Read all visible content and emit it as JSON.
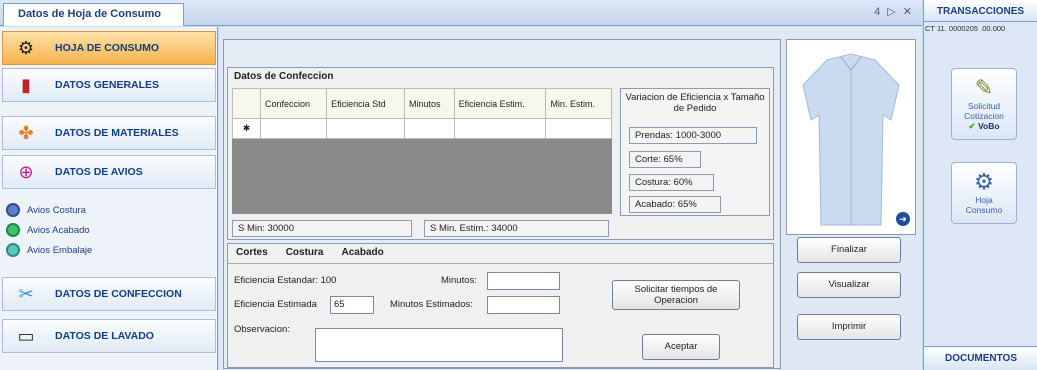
{
  "tab": {
    "title": "Datos de Hoja de Consumo",
    "controls": "4 ▷ ✕"
  },
  "sidebar": {
    "items": [
      {
        "label": "HOJA DE CONSUMO",
        "icon": "gear-doc-icon"
      },
      {
        "label": "DATOS GENERALES",
        "icon": "document-icon"
      },
      {
        "label": "DATOS DE MATERIALES",
        "icon": "shapes-icon"
      },
      {
        "label": "DATOS DE AVIOS",
        "icon": "button-icon"
      }
    ],
    "subitems": [
      "Avios Costura",
      "Avios Acabado",
      "Avios Embalaje"
    ],
    "items2": [
      {
        "label": "DATOS DE CONFECCION",
        "icon": "sewing-icon"
      },
      {
        "label": "DATOS DE LAVADO",
        "icon": "wash-icon"
      }
    ]
  },
  "confeccion": {
    "title": "Datos de Confeccion",
    "columns": [
      "Confeccion",
      "Eficiencia Std",
      "Minutos",
      "Eficiencia Estim.",
      "Min. Estim."
    ],
    "row_marker": "✱",
    "smin": "S Min: 30000",
    "smin_est": "S Min. Estim.: 34000"
  },
  "variacion": {
    "title": "Variacion de Eficiencia x Tamaño de Pedido",
    "prendas": "Prendas: 1000-3000",
    "corte": "Corte: 65%",
    "costura": "Costura: 60%",
    "acabado": "Acabado: 65%"
  },
  "tabs": [
    "Cortes",
    "Costura",
    "Acabado"
  ],
  "form": {
    "ef_std_label": "Eficiencia Estandar: 100",
    "ef_est_label": "Eficiencia Estimada",
    "ef_est_value": "65",
    "minutos_label": "Minutos:",
    "min_est_label": "Minutos Estimados:",
    "obs_label": "Observacion:"
  },
  "buttons": {
    "solicitar": "Solicitar tiempos de Operacion",
    "aceptar": "Aceptar",
    "finalizar": "Finalizar",
    "visualizar": "Visualizar",
    "imprimir": "Imprimir"
  },
  "right": {
    "header": "TRANSACCIONES",
    "code": "CT 11. 0000205 .00.000",
    "tile1_line1": "Solicitud",
    "tile1_line2": "Cotizacion",
    "vobo": "VoBo",
    "tile2_line1": "Hoja",
    "tile2_line2": "Consumo",
    "footer": "DOCUMENTOS"
  }
}
